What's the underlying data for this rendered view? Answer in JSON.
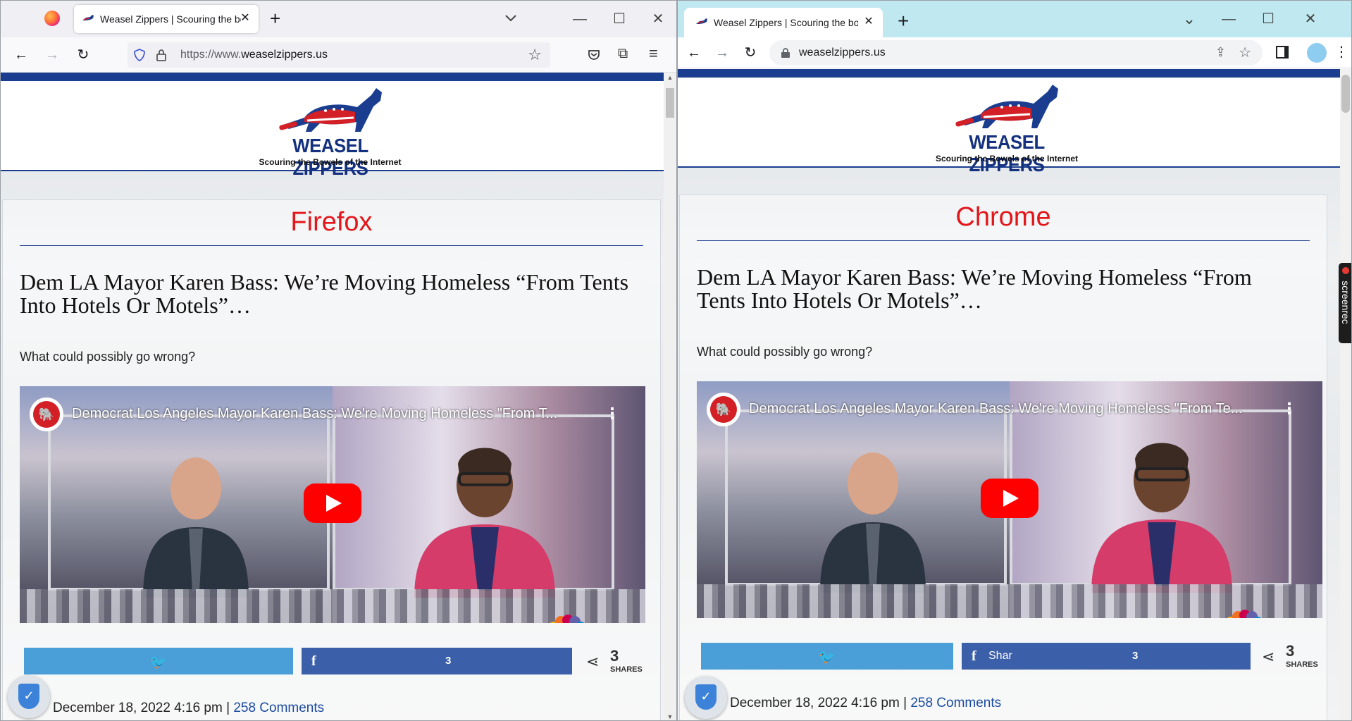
{
  "firefox": {
    "tab_title": "Weasel Zippers | Scouring the bo",
    "new_tab": "+",
    "url_prefix": "https://www.",
    "url_domain": "weaselzippers.us",
    "window": {
      "minimize": "—",
      "maximize": "☐",
      "close": "✕"
    }
  },
  "chrome": {
    "tab_title": "Weasel Zippers | Scouring the bo",
    "new_tab": "+",
    "url": "weaselzippers.us",
    "window": {
      "dropdown": "⌄",
      "minimize": "—",
      "maximize": "☐",
      "close": "✕"
    },
    "extension_tab": "screenrec"
  },
  "site": {
    "logo_name": "WEASEL ZIPPERS",
    "tagline": "Scouring the Bowels of the Internet",
    "colors": {
      "primary": "#1a3d8f",
      "label": "#e3161a",
      "twitter": "#4a9fd8",
      "facebook": "#3b5fa8"
    }
  },
  "pages": {
    "firefox": {
      "browser_label": "Firefox",
      "headline": "Dem LA Mayor Karen Bass: We’re Moving Homeless “From Tents Into Hotels Or Motels”…",
      "subline": "What could possibly go wrong?",
      "video_title": "Democrat Los Angeles Mayor Karen Bass: We're Moving Homeless \"From T...",
      "fb_count": "3",
      "fb_label": "",
      "share_total": "3",
      "shares_label": "SHARES",
      "date": "December 18, 2022 4:16 pm",
      "separator": " | ",
      "comments": "258 Comments"
    },
    "chrome": {
      "browser_label": "Chrome",
      "headline": "Dem LA Mayor Karen Bass: We’re Moving Homeless “From Tents Into Hotels Or Motels”…",
      "subline": "What could possibly go wrong?",
      "video_title": "Democrat Los Angeles Mayor Karen Bass: We're Moving Homeless \"From Te...",
      "fb_count": "3",
      "fb_label": "Shar",
      "share_total": "3",
      "shares_label": "SHARES",
      "date": "December 18, 2022 4:16 pm",
      "separator": " | ",
      "comments": "258 Comments"
    }
  }
}
